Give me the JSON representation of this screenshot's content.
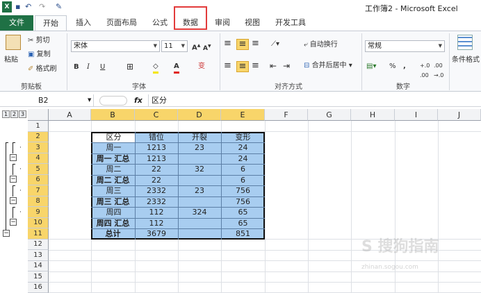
{
  "window": {
    "title": "工作簿2 - Microsoft Excel",
    "quick_access": [
      "save-icon",
      "undo-icon",
      "redo-icon",
      "customize-icon"
    ]
  },
  "tabs": [
    {
      "label": "文件"
    },
    {
      "label": "开始"
    },
    {
      "label": "插入"
    },
    {
      "label": "页面布局"
    },
    {
      "label": "公式"
    },
    {
      "label": "数据"
    },
    {
      "label": "审阅"
    },
    {
      "label": "视图"
    },
    {
      "label": "开发工具"
    }
  ],
  "ribbon": {
    "clipboard": {
      "paste": "粘贴",
      "cut": "剪切",
      "copy": "复制",
      "format_painter": "格式刷",
      "group": "剪贴板"
    },
    "font": {
      "name": "宋体",
      "size": "11",
      "group": "字体",
      "bold": "B",
      "italic": "I",
      "underline": "U",
      "wen": "变"
    },
    "alignment": {
      "wrap": "自动换行",
      "merge": "合并后居中",
      "group": "对齐方式"
    },
    "number": {
      "format": "常规",
      "percent": "%",
      "comma": ",",
      "group": "数字"
    },
    "styles": {
      "conditional": "条件格式"
    }
  },
  "formula_bar": {
    "name_box": "B2",
    "fx": "fx",
    "content": "区分"
  },
  "columns": [
    "A",
    "B",
    "C",
    "D",
    "E",
    "F",
    "G",
    "H",
    "I",
    "J"
  ],
  "rows": [
    "1",
    "2",
    "3",
    "4",
    "5",
    "6",
    "7",
    "8",
    "9",
    "10",
    "11",
    "12",
    "13",
    "14",
    "15",
    "16"
  ],
  "outline_levels": [
    "1",
    "2",
    "3"
  ],
  "table": {
    "header": [
      "区分",
      "错位",
      "开裂",
      "变形"
    ],
    "rows": [
      [
        "周一",
        "1213",
        "23",
        "24"
      ],
      [
        "周一 汇总",
        "1213",
        "",
        "24"
      ],
      [
        "周二",
        "22",
        "32",
        "6"
      ],
      [
        "周二 汇总",
        "22",
        "",
        "6"
      ],
      [
        "周三",
        "2332",
        "23",
        "756"
      ],
      [
        "周三 汇总",
        "2332",
        "",
        "756"
      ],
      [
        "周四",
        "112",
        "324",
        "65"
      ],
      [
        "周四 汇总",
        "112",
        "",
        "65"
      ],
      [
        "总计",
        "3679",
        "",
        "851"
      ]
    ]
  },
  "watermark": {
    "text": "S 搜狗指南",
    "sub": "zhinan.sogou.com"
  }
}
